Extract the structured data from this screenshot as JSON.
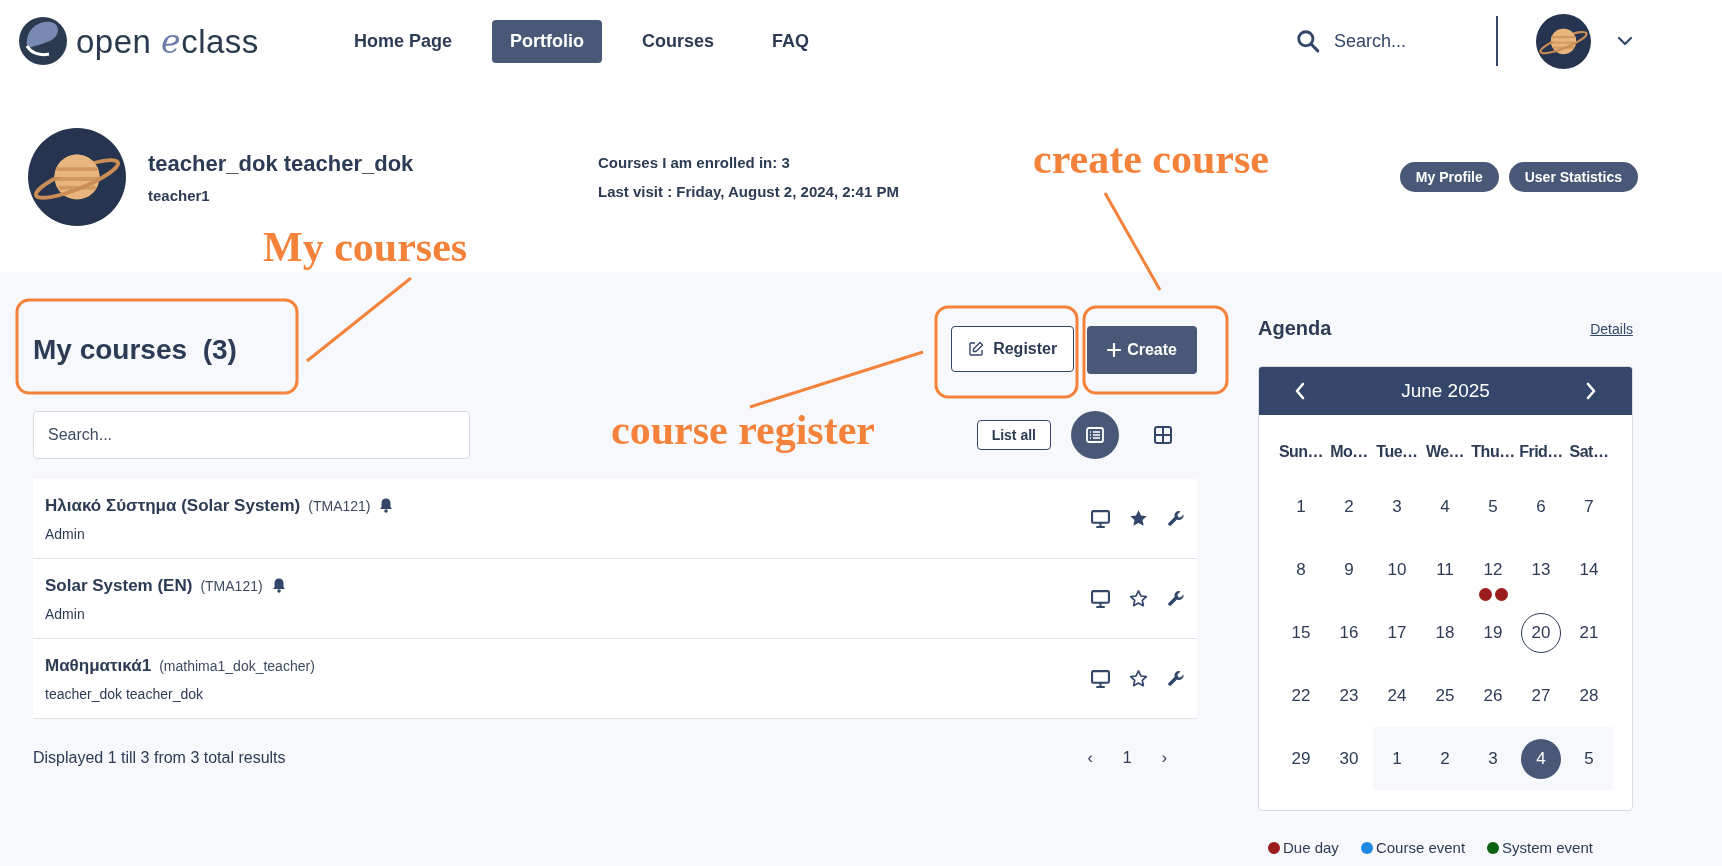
{
  "brand": {
    "first": "open",
    "accent": "e",
    "rest": "class"
  },
  "nav": [
    {
      "label": "Home Page",
      "selected": false
    },
    {
      "label": "Portfolio",
      "selected": true
    },
    {
      "label": "Courses",
      "selected": false
    },
    {
      "label": "FAQ",
      "selected": false
    }
  ],
  "search": {
    "placeholder": "Search..."
  },
  "profile": {
    "name": "teacher_dok teacher_dok",
    "username": "teacher1",
    "enrolled": "Courses I am enrolled in: 3",
    "last_visit": "Last visit : Friday, August 2, 2024, 2:41 PM",
    "buttons": [
      "My Profile",
      "User Statistics"
    ]
  },
  "my_courses": {
    "title": "My courses",
    "count": "(3)",
    "register": "Register",
    "create": "Create",
    "search_placeholder": "Search...",
    "list_all": "List all",
    "views": [
      {
        "kind": "list",
        "selected": true
      },
      {
        "kind": "grid",
        "selected": false
      }
    ],
    "courses": [
      {
        "title": "Ηλιακό Σύστημα (Solar System)",
        "code": "(TMA121)",
        "owner": "Admin",
        "bell": true,
        "starred": true
      },
      {
        "title": "Solar System (EN)",
        "code": "(TMA121)",
        "owner": "Admin",
        "bell": true,
        "starred": false
      },
      {
        "title": "Μαθηματικά1",
        "code": "(mathima1_dok_teacher)",
        "owner": "teacher_dok teacher_dok",
        "bell": false,
        "starred": false
      }
    ],
    "summary": "Displayed 1 till 3 from 3 total results",
    "pagination": [
      "‹",
      "1",
      "›"
    ]
  },
  "agenda": {
    "title": "Agenda",
    "details": "Details",
    "month": "June 2025",
    "weekdays": [
      "Sun…",
      "Mo…",
      "Tue…",
      "We…",
      "Thu…",
      "Frid…",
      "Sat…"
    ],
    "weeks": [
      [
        {
          "day": "1"
        },
        {
          "day": "2"
        },
        {
          "day": "3"
        },
        {
          "day": "4"
        },
        {
          "day": "5"
        },
        {
          "day": "6"
        },
        {
          "day": "7"
        }
      ],
      [
        {
          "day": "8"
        },
        {
          "day": "9"
        },
        {
          "day": "10"
        },
        {
          "day": "11"
        },
        {
          "day": "12",
          "events": [
            {
              "color": "#9b1c1c"
            },
            {
              "color": "#9b1c1c"
            }
          ]
        },
        {
          "day": "13"
        },
        {
          "day": "14"
        }
      ],
      [
        {
          "day": "15"
        },
        {
          "day": "16"
        },
        {
          "day": "17"
        },
        {
          "day": "18"
        },
        {
          "day": "19"
        },
        {
          "day": "20",
          "today": true
        },
        {
          "day": "21"
        }
      ],
      [
        {
          "day": "22"
        },
        {
          "day": "23"
        },
        {
          "day": "24"
        },
        {
          "day": "25"
        },
        {
          "day": "26"
        },
        {
          "day": "27"
        },
        {
          "day": "28"
        }
      ],
      [
        {
          "day": "29"
        },
        {
          "day": "30"
        },
        {
          "day": "1",
          "other_month": true
        },
        {
          "day": "2",
          "other_month": true
        },
        {
          "day": "3",
          "other_month": true
        },
        {
          "day": "4",
          "other_month": true,
          "selected": true
        },
        {
          "day": "5",
          "other_month": true
        }
      ]
    ],
    "legend": [
      {
        "label": "Due day",
        "color": "#9b1c1c"
      },
      {
        "label": "Course event",
        "color": "#1e88e5"
      },
      {
        "label": "System event",
        "color": "#0b6110"
      }
    ]
  },
  "annotations": [
    "My courses",
    "create course",
    "course register"
  ]
}
